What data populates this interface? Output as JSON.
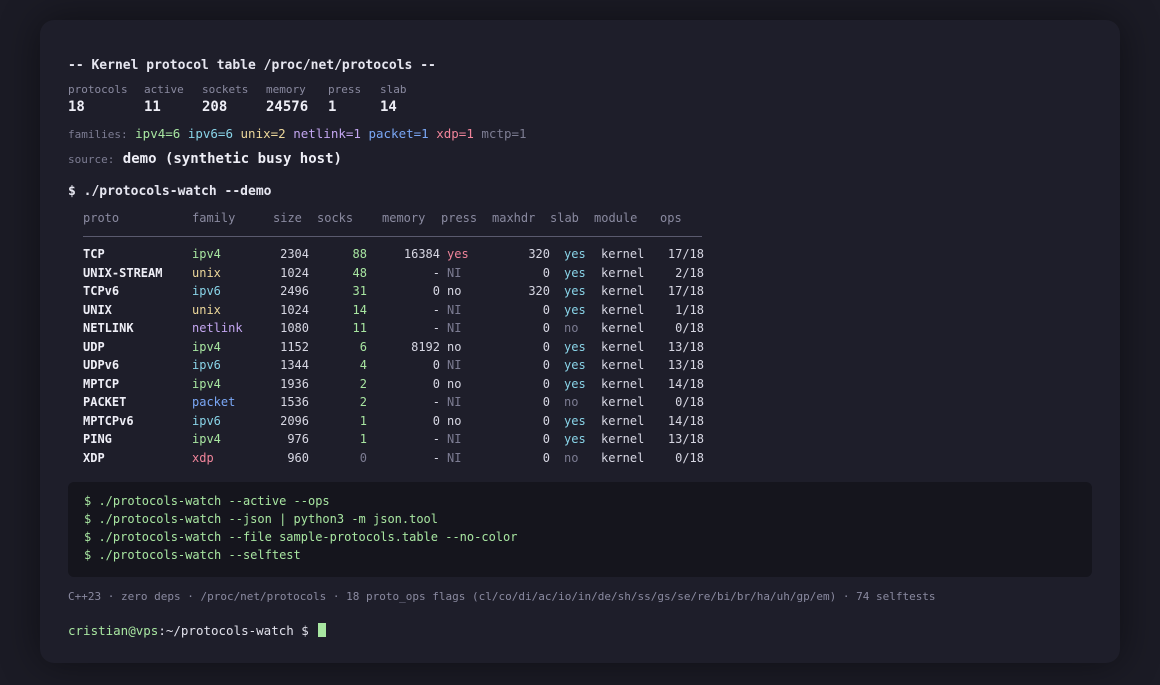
{
  "title": "-- Kernel protocol table /proc/net/protocols --",
  "stats": {
    "protocols": {
      "label": "protocols",
      "value": "18"
    },
    "active": {
      "label": "active",
      "value": "11"
    },
    "sockets": {
      "label": "sockets",
      "value": "208"
    },
    "memory": {
      "label": "memory",
      "value": "24576"
    },
    "press": {
      "label": "press",
      "value": "1"
    },
    "slab": {
      "label": "slab",
      "value": "14"
    }
  },
  "families": {
    "label": "families:",
    "ipv4": "ipv4=6",
    "ipv6": "ipv6=6",
    "unix": "unix=2",
    "netlink": "netlink=1",
    "packet": "packet=1",
    "xdp": "xdp=1",
    "mctp": "mctp=1"
  },
  "source": {
    "label": "source:",
    "value": "demo (synthetic busy host)"
  },
  "command": "$ ./protocols-watch --demo",
  "table": {
    "headers": {
      "proto": "proto",
      "family": "family",
      "size": "size",
      "socks": "socks",
      "memory": "memory",
      "press": "press",
      "maxhdr": "maxhdr",
      "slab": "slab",
      "module": "module",
      "ops": "ops"
    },
    "rows": [
      {
        "proto": "TCP",
        "family": "ipv4",
        "size": "2304",
        "socks": "88",
        "memory": "16384",
        "press": "yes",
        "maxhdr": "320",
        "slab": "yes",
        "module": "kernel",
        "ops": "17/18"
      },
      {
        "proto": "UNIX-STREAM",
        "family": "unix",
        "size": "1024",
        "socks": "48",
        "memory": "-",
        "press": "NI",
        "maxhdr": "0",
        "slab": "yes",
        "module": "kernel",
        "ops": "2/18"
      },
      {
        "proto": "TCPv6",
        "family": "ipv6",
        "size": "2496",
        "socks": "31",
        "memory": "0",
        "press": "no",
        "maxhdr": "320",
        "slab": "yes",
        "module": "kernel",
        "ops": "17/18"
      },
      {
        "proto": "UNIX",
        "family": "unix",
        "size": "1024",
        "socks": "14",
        "memory": "-",
        "press": "NI",
        "maxhdr": "0",
        "slab": "yes",
        "module": "kernel",
        "ops": "1/18"
      },
      {
        "proto": "NETLINK",
        "family": "netlink",
        "size": "1080",
        "socks": "11",
        "memory": "-",
        "press": "NI",
        "maxhdr": "0",
        "slab": "no",
        "module": "kernel",
        "ops": "0/18"
      },
      {
        "proto": "UDP",
        "family": "ipv4",
        "size": "1152",
        "socks": "6",
        "memory": "8192",
        "press": "no",
        "maxhdr": "0",
        "slab": "yes",
        "module": "kernel",
        "ops": "13/18"
      },
      {
        "proto": "UDPv6",
        "family": "ipv6",
        "size": "1344",
        "socks": "4",
        "memory": "0",
        "press": "NI",
        "maxhdr": "0",
        "slab": "yes",
        "module": "kernel",
        "ops": "13/18"
      },
      {
        "proto": "MPTCP",
        "family": "ipv4",
        "size": "1936",
        "socks": "2",
        "memory": "0",
        "press": "no",
        "maxhdr": "0",
        "slab": "yes",
        "module": "kernel",
        "ops": "14/18"
      },
      {
        "proto": "PACKET",
        "family": "packet",
        "size": "1536",
        "socks": "2",
        "memory": "-",
        "press": "NI",
        "maxhdr": "0",
        "slab": "no",
        "module": "kernel",
        "ops": "0/18"
      },
      {
        "proto": "MPTCPv6",
        "family": "ipv6",
        "size": "2096",
        "socks": "1",
        "memory": "0",
        "press": "no",
        "maxhdr": "0",
        "slab": "yes",
        "module": "kernel",
        "ops": "14/18"
      },
      {
        "proto": "PING",
        "family": "ipv4",
        "size": "976",
        "socks": "1",
        "memory": "-",
        "press": "NI",
        "maxhdr": "0",
        "slab": "yes",
        "module": "kernel",
        "ops": "13/18"
      },
      {
        "proto": "XDP",
        "family": "xdp",
        "size": "960",
        "socks": "0",
        "memory": "-",
        "press": "NI",
        "maxhdr": "0",
        "slab": "no",
        "module": "kernel",
        "ops": "0/18"
      }
    ]
  },
  "examples": [
    {
      "prompt": "$ ",
      "cmd": "./protocols-watch --active --ops"
    },
    {
      "prompt": "$ ",
      "cmd": "./protocols-watch --json | python3 -m json.tool"
    },
    {
      "prompt": "$ ",
      "cmd": "./protocols-watch --file sample-protocols.table --no-color"
    },
    {
      "prompt": "$ ",
      "cmd": "./protocols-watch --selftest"
    }
  ],
  "footer": "C++23 · zero deps · /proc/net/protocols · 18 proto_ops flags (cl/co/di/ac/io/in/de/sh/ss/gs/se/re/bi/br/ha/uh/gp/em) · 74 selftests",
  "prompt": {
    "user": "cristian@vps",
    "path": ":~/protocols-watch $"
  },
  "colors": {
    "ipv4": "#a8e6a1",
    "ipv6": "#89d4e8",
    "unix": "#ecd79a",
    "netlink": "#c3a6f0",
    "packet": "#7aa7f5",
    "xdp": "#f0849a",
    "mctp": "#7c7c92",
    "yes_press": "#f0849a",
    "yes_slab": "#89d4e8",
    "muted": "#7c7c92",
    "socks": "#a8e6a1"
  }
}
